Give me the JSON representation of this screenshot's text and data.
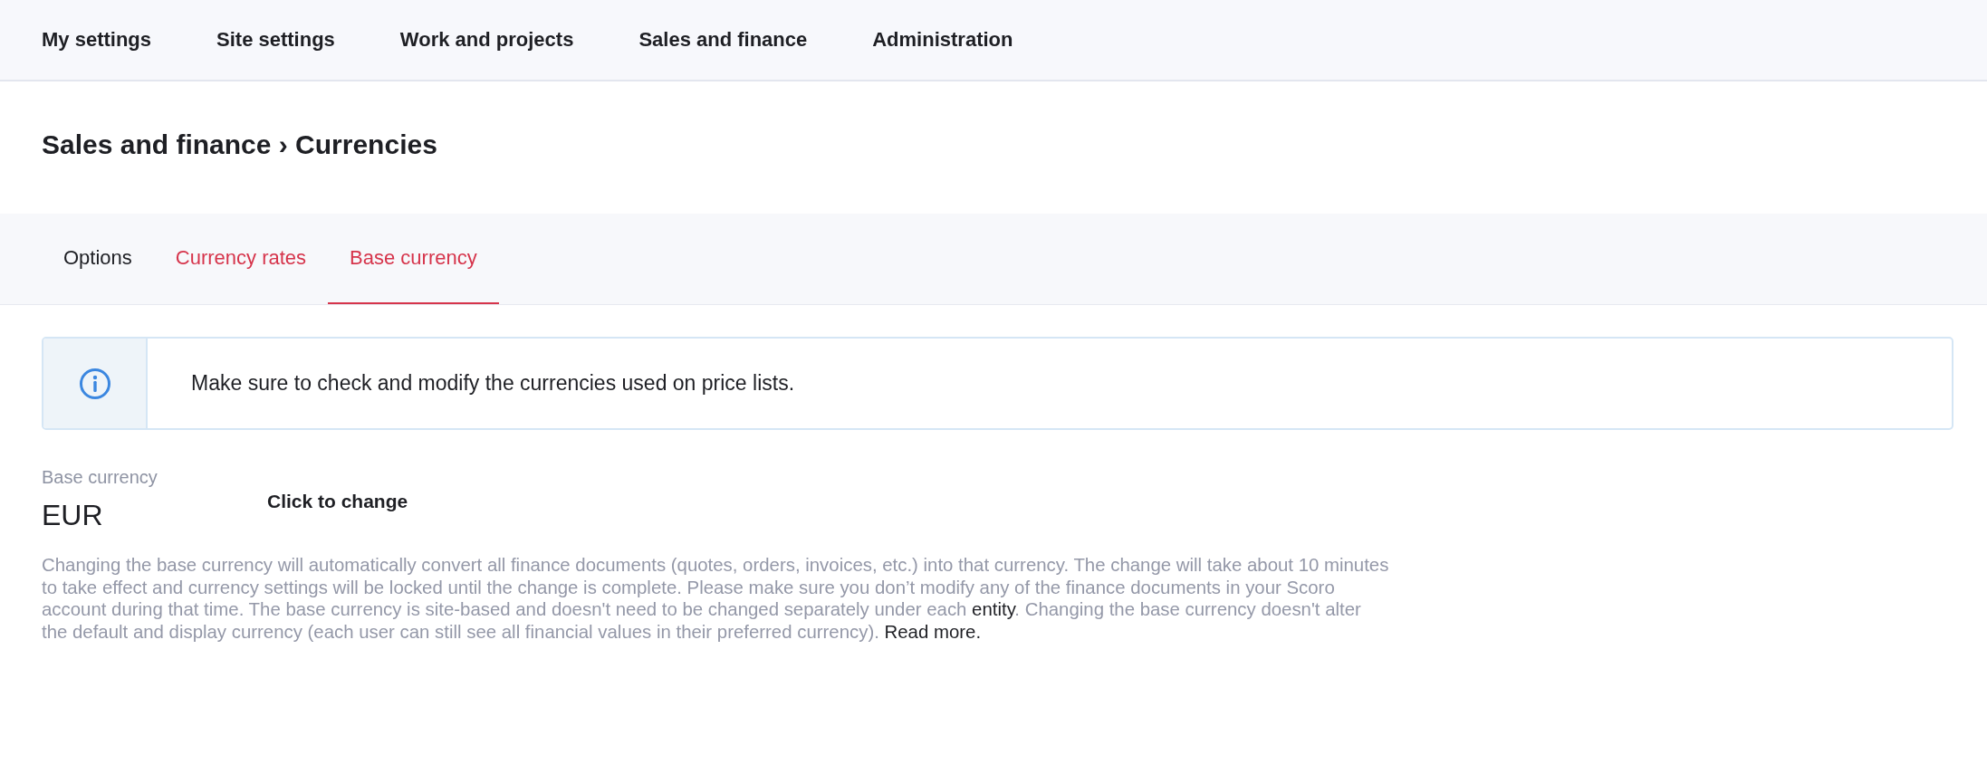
{
  "top_nav": {
    "items": [
      {
        "label": "My settings"
      },
      {
        "label": "Site settings"
      },
      {
        "label": "Work and projects"
      },
      {
        "label": "Sales and finance"
      },
      {
        "label": "Administration"
      }
    ]
  },
  "page_title": "Sales and finance › Currencies",
  "tabs": [
    {
      "label": "Options",
      "selected": false,
      "color": "#1e1f24"
    },
    {
      "label": "Currency rates",
      "selected": false,
      "color": "#d6344b"
    },
    {
      "label": "Base currency",
      "selected": true,
      "color": "#d6344b"
    }
  ],
  "info_banner": {
    "text": "Make sure to check and modify the currencies used on price lists."
  },
  "base_currency": {
    "label": "Base currency",
    "value": "EUR",
    "action": "Click to change"
  },
  "description": [
    {
      "kind": "text",
      "text": "Changing the base currency will automatically convert all finance documents (quotes, orders, invoices, etc.) into that currency. The change will take about 10 minutes to take effect and currency settings will be locked until the change is complete. Please make sure you don’t modify any of the finance documents in your Scoro account during that time. The base currency is site-based and doesn't need to be changed separately under each "
    },
    {
      "kind": "link",
      "text": "entity"
    },
    {
      "kind": "text",
      "text": ". Changing the base currency doesn't alter the default and display currency (each user can still see all financial values in their preferred currency). "
    },
    {
      "kind": "link",
      "text": "Read more."
    }
  ]
}
